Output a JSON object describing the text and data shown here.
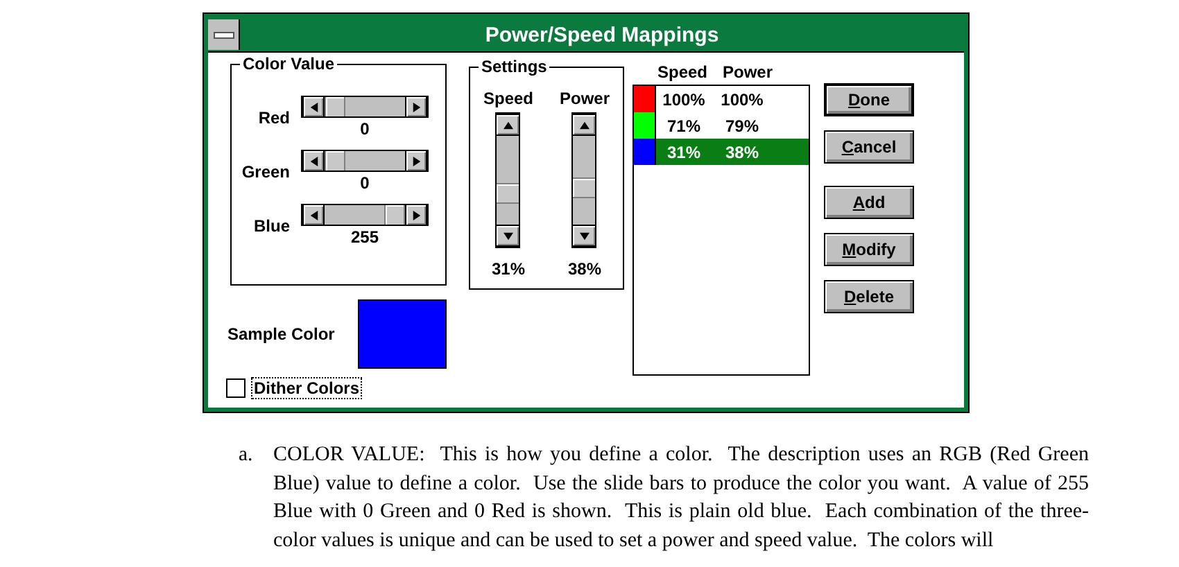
{
  "window": {
    "title": "Power/Speed Mappings"
  },
  "color_value": {
    "title": "Color Value",
    "sliders": [
      {
        "label": "Red",
        "level": 0,
        "reading": "0"
      },
      {
        "label": "Green",
        "level": 0,
        "reading": "0"
      },
      {
        "label": "Blue",
        "level": 1,
        "reading": "255"
      }
    ]
  },
  "settings": {
    "title": "Settings",
    "scrollbars": [
      {
        "label": "Speed",
        "level": 0.31,
        "reading": "31%"
      },
      {
        "label": "Power",
        "level": 0.38,
        "reading": "38%"
      }
    ]
  },
  "sample": {
    "label": "Sample Color",
    "color": "#0000ff"
  },
  "dither": {
    "label": "Dither Colors",
    "checked": false
  },
  "list": {
    "columns": [
      "Speed",
      "Power"
    ],
    "rows": [
      {
        "color": "#ff0000",
        "speed": "100%",
        "power": "100%",
        "selected": false
      },
      {
        "color": "#00ff00",
        "speed": "71%",
        "power": "79%",
        "selected": false
      },
      {
        "color": "#0000ff",
        "speed": "31%",
        "power": "38%",
        "selected": true
      }
    ]
  },
  "buttons": [
    {
      "label": "Done",
      "default": true,
      "underline_first": true
    },
    {
      "label": "Cancel",
      "default": false,
      "underline_first": true
    },
    {
      "label": "Add",
      "default": false,
      "underline_first": true
    },
    {
      "label": "Modify",
      "default": false,
      "underline_first": true
    },
    {
      "label": "Delete",
      "default": false,
      "underline_first": true
    }
  ],
  "document": {
    "marker": "a.",
    "paragraph": "COLOR VALUE:  This is how you define a color.  The description uses an RGB (Red Green Blue) value to define a color.  Use the slide bars to produce the color you want.  A value of 255 Blue with 0 Green and 0 Red is shown.  This is plain old blue.  Each combination of the three-color values is unique and can be used to set a power and speed value.  The colors will"
  }
}
